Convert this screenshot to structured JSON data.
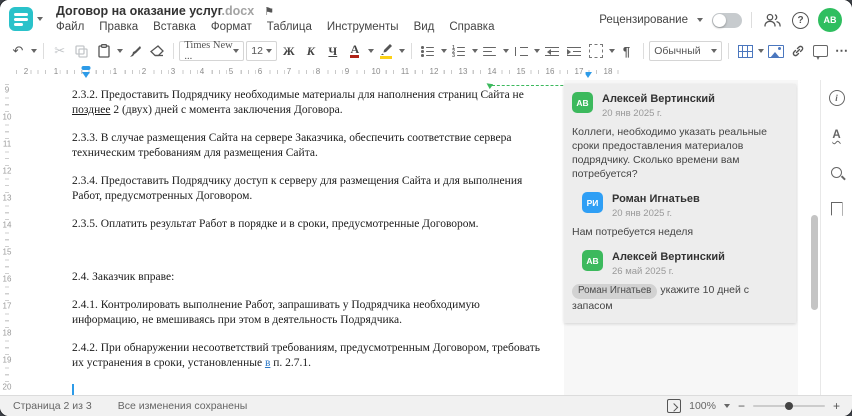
{
  "window": {
    "title": "Договор на оказание услуг",
    "title_ext": ".docx"
  },
  "menu": {
    "items": [
      "Файл",
      "Правка",
      "Вставка",
      "Формат",
      "Таблица",
      "Инструменты",
      "Вид",
      "Справка"
    ]
  },
  "header_right": {
    "review_label": "Рецензирование",
    "review_toggle_on": false,
    "avatar_initials": "АВ"
  },
  "toolbar": {
    "font_name": "Times New ...",
    "font_size": "12",
    "bold_label": "Ж",
    "italic_label": "К",
    "underline_label": "Ч",
    "font_color_label": "А",
    "style_name": "Обычный",
    "pilcrow": "¶"
  },
  "icons": {
    "undo": "↶",
    "cut": "✂",
    "flag": "⚑",
    "more": "⋯",
    "link": "⚭",
    "help": "?",
    "info": "i",
    "spell": "А",
    "minus": "−",
    "plus": "+"
  },
  "ruler": {
    "left_numbers": [
      "2",
      "1"
    ],
    "numbers": [
      "1",
      "2",
      "3",
      "4",
      "5",
      "6",
      "7",
      "8",
      "9",
      "10",
      "11",
      "12",
      "13",
      "14",
      "15",
      "16",
      "17",
      "18"
    ],
    "vertical_numbers": [
      "9",
      "10",
      "11",
      "12",
      "13",
      "14",
      "15",
      "16",
      "17",
      "18",
      "19",
      "20"
    ]
  },
  "document": {
    "paragraphs": [
      {
        "lines": [
          [
            {
              "text": "2.3.2. Предоставить Подрядчику необходимые материалы для наполнения страниц Сайта не"
            }
          ],
          [
            {
              "text": "позднее",
              "style": "underline"
            },
            {
              "text": " 2 (двух) дней с момента заключения Договора."
            }
          ]
        ]
      },
      {
        "lines": [
          [
            {
              "text": "2.3.3. В случае размещения Сайта на сервере Заказчика, обеспечить соответствие сервера"
            }
          ],
          [
            {
              "text": "техническим требованиям для размещения Сайта."
            }
          ]
        ]
      },
      {
        "lines": [
          [
            {
              "text": "2.3.4. Предоставить Подрядчику доступ к серверу для размещения Сайта и для выполнения"
            }
          ],
          [
            {
              "text": "Работ, предусмотренных Договором."
            }
          ]
        ]
      },
      {
        "extra_gap": true,
        "lines": [
          [
            {
              "text": "2.3.5. Оплатить результат Работ в порядке и в сроки, предусмотренные Договором."
            }
          ]
        ]
      },
      {
        "lines": [
          [
            {
              "text": "2.4. Заказчик вправе:"
            }
          ]
        ]
      },
      {
        "lines": [
          [
            {
              "text": "2.4.1. Контролировать выполнение Работ, запрашивать у Подрядчика необходимую"
            }
          ],
          [
            {
              "text": "информацию, не вмешиваясь при этом в деятельность Подрядчика."
            }
          ]
        ]
      },
      {
        "lines": [
          [
            {
              "text": "2.4.2. При обнаружении несоответствий требованиям, предусмотренным Договором, требовать"
            }
          ],
          [
            {
              "text": "их устранения в сроки, установленные "
            },
            {
              "text": "в",
              "style": "insert"
            },
            {
              "text": " п. 2.7.1."
            }
          ]
        ]
      }
    ]
  },
  "comments": [
    {
      "initials": "АВ",
      "color": "green",
      "name": "Алексей Вертинский",
      "date": "20 янв 2025 г.",
      "text": "Коллеги, необходимо указать реальные сроки предоставления материалов подрядчику. Сколько времени вам потребуется?",
      "reply": false
    },
    {
      "initials": "РИ",
      "color": "blue",
      "name": "Роман Игнатьев",
      "date": "20 янв 2025 г.",
      "text": "Нам потребуется неделя",
      "reply": true
    },
    {
      "initials": "АВ",
      "color": "green",
      "name": "Алексей Вертинский",
      "date": "26 май 2025 г.",
      "mention": "Роман Игнатьев",
      "text": "укажите 10 дней с запасом",
      "reply": true
    }
  ],
  "status_bar": {
    "page_label": "Страница 2 из 3",
    "saved_label": "Все изменения сохранены",
    "zoom_value": "100%"
  },
  "colors": {
    "brand_teal": "#2ac2ca",
    "green": "#3cb95d",
    "blue": "#2f9ff5",
    "avatar_green": "#2fbe5f",
    "toolbar_blue": "#4b77be",
    "marker_blue": "#2d9be8"
  }
}
